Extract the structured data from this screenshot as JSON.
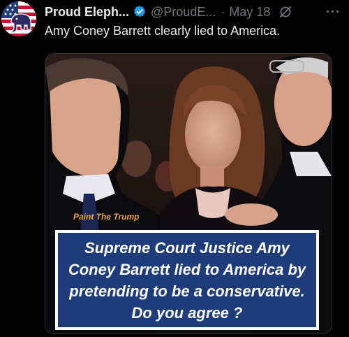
{
  "tweet": {
    "display_name": "Proud Eleph...",
    "handle": "@ProudE...",
    "separator": "·",
    "date": "May 18",
    "more": "···",
    "text": "Amy Coney Barrett clearly lied to America."
  },
  "media": {
    "watermark": "Paint The Trump",
    "caption": "Supreme Court Justice Amy Coney Barrett lied to America by pretending to be a conservative. Do you agree ?"
  },
  "colors": {
    "background": "#000000",
    "text_primary": "#e7e9ea",
    "text_secondary": "#71767b",
    "verified_badge": "#1d9bf0",
    "caption_background": "#1f3c7a",
    "watermark": "#f0a33a"
  },
  "icons": {
    "verified": "verified-badge-icon",
    "grok": "grok-icon",
    "more": "more-options-icon",
    "avatar": "elephant-flag-avatar"
  }
}
